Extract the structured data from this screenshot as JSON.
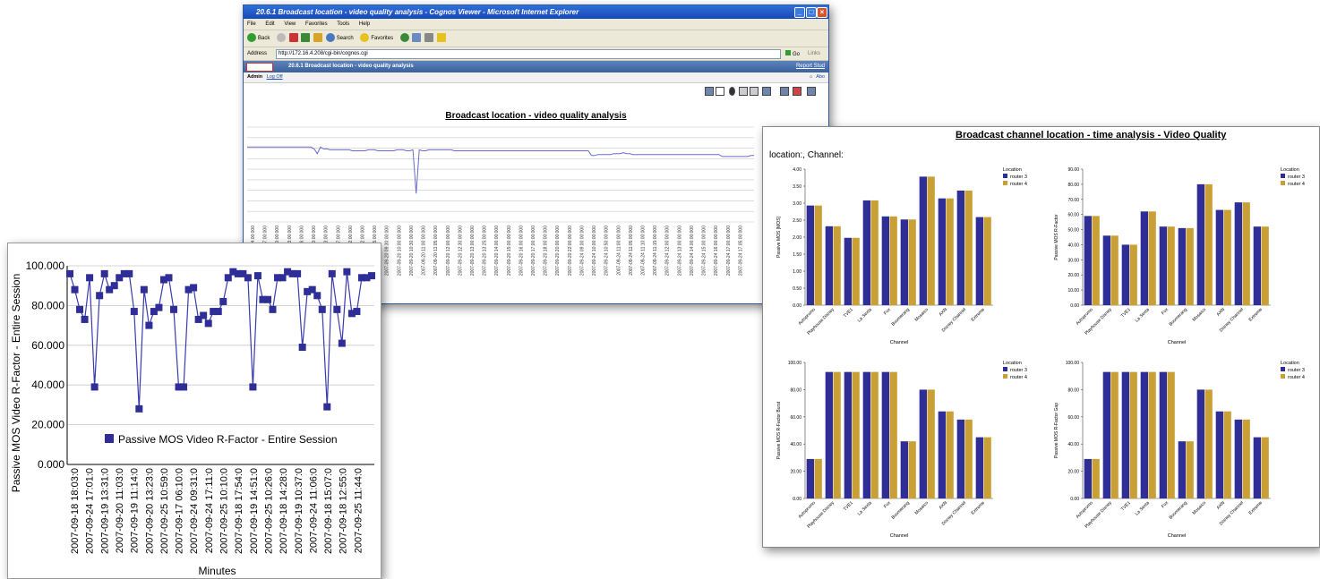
{
  "browser": {
    "window_title": "20.6.1 Broadcast location - video quality analysis - Cognos Viewer - Microsoft Internet Explorer",
    "menu": [
      "File",
      "Edit",
      "View",
      "Favorites",
      "Tools",
      "Help"
    ],
    "toolbar": {
      "back": "Back",
      "search": "Search",
      "favorites": "Favorites"
    },
    "address_label": "Address",
    "address_value": "http://172.16.4.208/cgi-bin/cognos.cgi",
    "go": "Go",
    "links": "Links",
    "cognos_title": "20.6.1 Broadcast location - video quality analysis",
    "report_studio": "Report Stud",
    "admin": "Admin",
    "logoff": "Log Off",
    "about": "Abo",
    "report_title": "Broadcast location - video quality analysis"
  },
  "right_report": {
    "title": "Broadcast channel location - time analysis - Video Quality",
    "subtitle": "location:, Channel:"
  },
  "chart_data": [
    {
      "id": "browser-line",
      "type": "line",
      "title": "Broadcast location - video quality analysis",
      "note": "axis labels too small to read; values approximate",
      "values": [
        79,
        79,
        79,
        79,
        79,
        79,
        79,
        79,
        79,
        79,
        79,
        79,
        79,
        79,
        79,
        79,
        79,
        79,
        79,
        79,
        79,
        77,
        72,
        79,
        77,
        77,
        76,
        76,
        76,
        76,
        76,
        76,
        76,
        75,
        75,
        75,
        75,
        75,
        76,
        76,
        76,
        75,
        75,
        75,
        75,
        75,
        75,
        76,
        76,
        76,
        75,
        75,
        76,
        30,
        76,
        75,
        75,
        76,
        76,
        76,
        76,
        76,
        76,
        76,
        76,
        75,
        75,
        75,
        75,
        75,
        75,
        75,
        75,
        75,
        75,
        75,
        75,
        75,
        75,
        75,
        75,
        75,
        75,
        75,
        75,
        75,
        75,
        75,
        75,
        75,
        75,
        75,
        75,
        75,
        75,
        75,
        75,
        75,
        75,
        75,
        75,
        75,
        75,
        75,
        75,
        75,
        75,
        75,
        70,
        70,
        71,
        71,
        71,
        71,
        71,
        72,
        72,
        72,
        73,
        72,
        72,
        71,
        71,
        71,
        71,
        71,
        71,
        71,
        71,
        71,
        71,
        71,
        71,
        71,
        71,
        71,
        71,
        71,
        71,
        71,
        71,
        71,
        71,
        71,
        71,
        71,
        71,
        71,
        71,
        69,
        69,
        69,
        69,
        69,
        69,
        69,
        69,
        69,
        70,
        70
      ],
      "x_labels": [
        "2007-09-19 13:44:00:000",
        "2007-09-19 13:47:00:000",
        "2007-09-19 13:50:00:000",
        "2007-09-19 13:53:00:000",
        "2007-09-19 13:56:00:000",
        "2007-09-19 14:00:00:000",
        "2007-09-19 14:03:00:000",
        "2007-09-19 14:07:00:000",
        "2007-09-19 14:12:00:000",
        "2007-09-20 09:12:00:000",
        "2007-09-20 09:15:00:000",
        "2007-09-20 09:30:00:000",
        "2007-09-20 10:00:00:000",
        "2007-09-20 10:30:00:000",
        "2007-09-20 11:00:00:000",
        "2007-09-20 11:05:00:000",
        "2007-09-20 12:00:00:000",
        "2007-09-20 12:30:00:000",
        "2007-09-20 13:00:00:000",
        "2007-09-20 13:25:00:000",
        "2007-09-20 14:00:00:000",
        "2007-09-20 15:00:00:000",
        "2007-09-20 16:00:00:000",
        "2007-09-20 17:00:00:000",
        "2007-09-20 18:00:00:000",
        "2007-09-20 20:00:00:000",
        "2007-09-20 22:00:00:000",
        "2007-09-24 09:00:00:000",
        "2007-09-24 10:00:00:000",
        "2007-09-24 10:50:00:000",
        "2007-09-24 11:00:00:000",
        "2007-09-24 11:05:00:000",
        "2007-09-24 11:10:00:000",
        "2007-09-24 11:15:00:000",
        "2007-09-24 12:00:00:000",
        "2007-09-24 13:00:00:000",
        "2007-09-24 14:00:00:000",
        "2007-09-24 15:00:00:000",
        "2007-09-24 16:00:00:000",
        "2007-09-24 17:00:00:000",
        "2007-09-24 17:05:00:000"
      ]
    },
    {
      "id": "left-line",
      "type": "line",
      "ylabel": "Passive MOS Video R-Factor - Entire Session",
      "xlabel": "Minutes",
      "ylim": [
        0,
        100
      ],
      "yticks": [
        "0.000",
        "20.000",
        "40.000",
        "60.000",
        "80.000",
        "100.000"
      ],
      "x_tick_labels": [
        "2007-09-18 18:03:0",
        "2007-09-24 17:01:0",
        "2007-09-19 13:31:0",
        "2007-09-20 11:03:0",
        "2007-09-19 11:14:0",
        "2007-09-20 13:23:0",
        "2007-09-25 10:59:0",
        "2007-09-17 06:10:0",
        "2007-09-24 09:31:0",
        "2007-09-24 17:11:0",
        "2007-09-25 10:10:0",
        "2007-09-18 17:54:0",
        "2007-09-19 14:51:0",
        "2007-09-25 10:26:0",
        "2007-09-18 14:28:0",
        "2007-09-19 10:37:0",
        "2007-09-24 11:06:0",
        "2007-09-18 15:07:0",
        "2007-09-18 12:55:0",
        "2007-09-25 11:44:0"
      ],
      "series": [
        {
          "name": "Passive MOS Video R-Factor - Entire Session",
          "values": [
            96,
            88,
            78,
            73,
            94,
            39,
            85,
            96,
            88,
            90,
            94,
            96,
            96,
            77,
            28,
            88,
            70,
            77,
            79,
            93,
            94,
            78,
            39,
            39,
            88,
            89,
            73,
            75,
            71,
            77,
            77,
            82,
            94,
            97,
            96,
            96,
            94,
            39,
            95,
            83,
            83,
            78,
            94,
            94,
            97,
            96,
            96,
            59,
            87,
            88,
            85,
            78,
            29,
            96,
            78,
            61,
            97,
            76,
            77,
            94,
            94,
            95
          ]
        }
      ]
    },
    {
      "id": "chart-mos",
      "type": "bar",
      "xlabel": "Channel",
      "ylabel": "Passive MOS [MOS]",
      "ylim": [
        0,
        4
      ],
      "yticks": [
        "0.00",
        "0.50",
        "1.00",
        "1.50",
        "2.00",
        "2.50",
        "3.00",
        "3.50",
        "4.00"
      ],
      "legend_title": "Location",
      "categories": [
        "Autopromo",
        "Playhouse Disney",
        "TVE1",
        "La Sexta",
        "Fox",
        "Boomerang",
        "Mosaico",
        "AXN",
        "Disney Channel",
        "Extreme"
      ],
      "series": [
        {
          "name": "router 3",
          "values": [
            2.93,
            2.32,
            1.98,
            3.08,
            2.61,
            2.52,
            3.78,
            3.14,
            3.37,
            2.59
          ]
        },
        {
          "name": "router 4",
          "values": [
            2.93,
            2.32,
            1.98,
            3.08,
            2.61,
            2.52,
            3.78,
            3.14,
            3.37,
            2.59
          ]
        }
      ]
    },
    {
      "id": "chart-rfactor",
      "type": "bar",
      "xlabel": "Channel",
      "ylabel": "Passive MOS R-Factor",
      "ylim": [
        0,
        90
      ],
      "yticks": [
        "0.00",
        "10.00",
        "20.00",
        "30.00",
        "40.00",
        "50.00",
        "60.00",
        "70.00",
        "80.00",
        "90.00"
      ],
      "legend_title": "Location",
      "categories": [
        "Autopromo",
        "Playhouse Disney",
        "TVE1",
        "La Sexta",
        "Fox",
        "Boomerang",
        "Mosaico",
        "AXN",
        "Disney Channel",
        "Extreme"
      ],
      "series": [
        {
          "name": "router 3",
          "values": [
            59,
            46,
            40,
            62,
            52,
            51,
            80,
            63,
            68,
            52
          ]
        },
        {
          "name": "router 4",
          "values": [
            59,
            46,
            40,
            62,
            52,
            51,
            80,
            63,
            68,
            52
          ]
        }
      ]
    },
    {
      "id": "chart-burst",
      "type": "bar",
      "xlabel": "Channel",
      "ylabel": "Passive MOS R-Factor Burst",
      "ylim": [
        0,
        100
      ],
      "yticks": [
        "0.00",
        "20.00",
        "40.00",
        "60.00",
        "80.00",
        "100.00"
      ],
      "legend_title": "Location",
      "categories": [
        "Autopromo",
        "Playhouse Disney",
        "TVE1",
        "La Sexta",
        "Fox",
        "Boomerang",
        "Mosaico",
        "AXN",
        "Disney Channel",
        "Extreme"
      ],
      "series": [
        {
          "name": "router 3",
          "values": [
            29,
            93,
            93,
            93,
            93,
            42,
            80,
            64,
            58,
            45
          ]
        },
        {
          "name": "router 4",
          "values": [
            29,
            93,
            93,
            93,
            93,
            42,
            80,
            64,
            58,
            45
          ]
        }
      ]
    },
    {
      "id": "chart-gap",
      "type": "bar",
      "xlabel": "Channel",
      "ylabel": "Passive MOS R-Factor Gap",
      "ylim": [
        0,
        100
      ],
      "yticks": [
        "0.00",
        "20.00",
        "40.00",
        "60.00",
        "80.00",
        "100.00"
      ],
      "legend_title": "Location",
      "categories": [
        "Autopromo",
        "Playhouse Disney",
        "TVE1",
        "La Sexta",
        "Fox",
        "Boomerang",
        "Mosaico",
        "AXN",
        "Disney Channel",
        "Extreme"
      ],
      "series": [
        {
          "name": "router 3",
          "values": [
            29,
            93,
            93,
            93,
            93,
            42,
            80,
            64,
            58,
            45
          ]
        },
        {
          "name": "router 4",
          "values": [
            29,
            93,
            93,
            93,
            93,
            42,
            80,
            64,
            58,
            45
          ]
        }
      ]
    }
  ],
  "colors": {
    "series_a": "#2e2e96",
    "series_b": "#c8a036",
    "line": "#3b3bb0",
    "grid": "#c8c8c8"
  }
}
